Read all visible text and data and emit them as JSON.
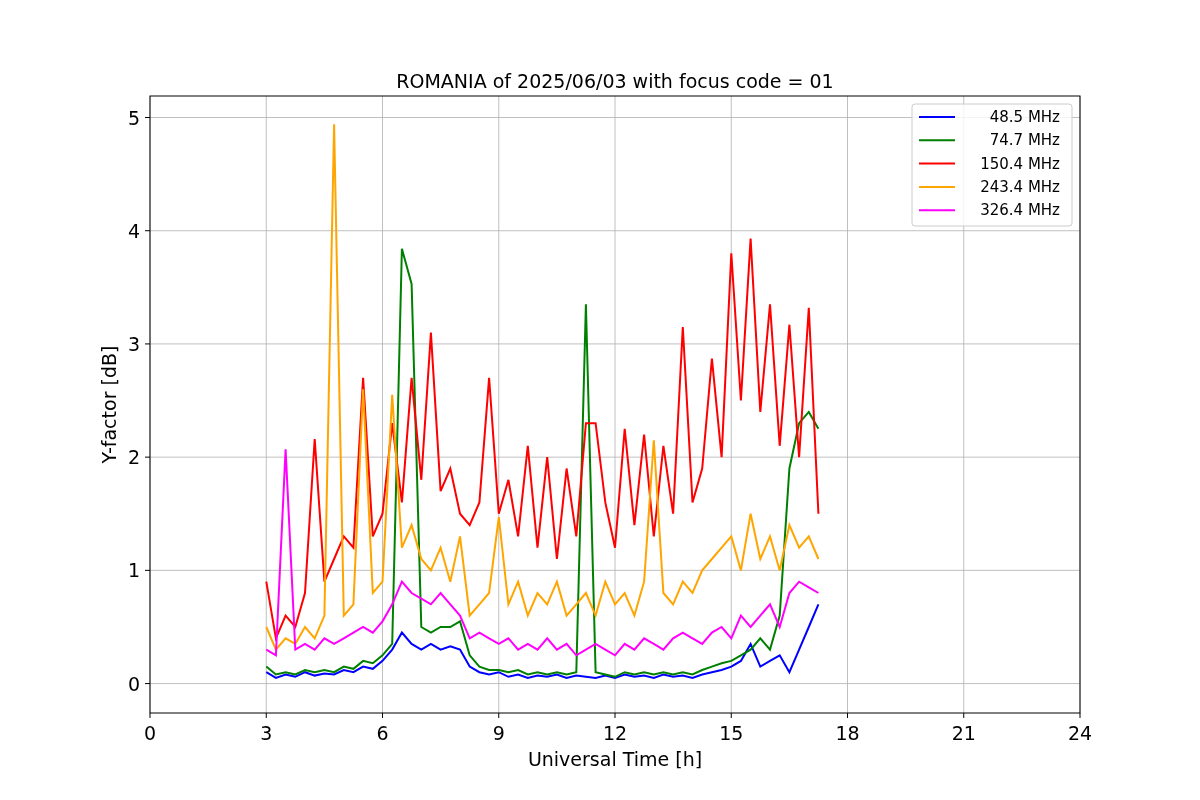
{
  "chart_data": {
    "type": "line",
    "title": "ROMANIA of 2025/06/03 with focus code = 01",
    "xlabel": "Universal Time [h]",
    "ylabel": "Y-factor [dB]",
    "x": [
      3,
      3.25,
      3.5,
      3.75,
      4,
      4.25,
      4.5,
      4.75,
      5,
      5.25,
      5.5,
      5.75,
      6,
      6.25,
      6.5,
      6.75,
      7,
      7.25,
      7.5,
      7.75,
      8,
      8.25,
      8.5,
      8.75,
      9,
      9.25,
      9.5,
      9.75,
      10,
      10.25,
      10.5,
      10.75,
      11,
      11.25,
      11.5,
      11.75,
      12,
      12.25,
      12.5,
      12.75,
      13,
      13.25,
      13.5,
      13.75,
      14,
      14.25,
      14.5,
      14.75,
      15,
      15.25,
      15.5,
      15.75,
      16,
      16.25,
      16.5,
      16.75,
      17,
      17.25
    ],
    "series": [
      {
        "name": "48.5 MHz",
        "color": "#0000ff",
        "values": [
          0.1,
          0.05,
          0.08,
          0.06,
          0.1,
          0.07,
          0.09,
          0.08,
          0.12,
          0.1,
          0.15,
          0.13,
          0.2,
          0.3,
          0.45,
          0.35,
          0.3,
          0.35,
          0.3,
          0.33,
          0.3,
          0.15,
          0.1,
          0.08,
          0.1,
          0.06,
          0.08,
          0.05,
          0.07,
          0.06,
          0.08,
          0.05,
          0.07,
          0.06,
          0.05,
          0.07,
          0.05,
          0.08,
          0.06,
          0.07,
          0.05,
          0.08,
          0.06,
          0.07,
          0.05,
          0.08,
          0.1,
          0.12,
          0.15,
          0.2,
          0.35,
          0.15,
          0.2,
          0.25,
          0.1,
          0.3,
          0.5,
          0.7
        ]
      },
      {
        "name": "74.7 MHz",
        "color": "#008000",
        "values": [
          0.15,
          0.08,
          0.1,
          0.08,
          0.12,
          0.1,
          0.12,
          0.1,
          0.15,
          0.13,
          0.2,
          0.18,
          0.25,
          0.35,
          3.84,
          3.53,
          0.5,
          0.45,
          0.5,
          0.5,
          0.55,
          0.25,
          0.15,
          0.12,
          0.12,
          0.1,
          0.12,
          0.08,
          0.1,
          0.08,
          0.1,
          0.08,
          0.1,
          3.35,
          0.1,
          0.08,
          0.06,
          0.1,
          0.08,
          0.1,
          0.08,
          0.1,
          0.08,
          0.1,
          0.08,
          0.12,
          0.15,
          0.18,
          0.2,
          0.25,
          0.3,
          0.4,
          0.3,
          0.6,
          1.9,
          2.3,
          2.4,
          2.25
        ]
      },
      {
        "name": "150.4 MHz",
        "color": "#ff0000",
        "values": [
          0.9,
          0.4,
          0.6,
          0.5,
          0.8,
          2.16,
          0.9,
          1.1,
          1.3,
          1.2,
          2.7,
          1.3,
          1.5,
          2.3,
          1.6,
          2.7,
          1.8,
          3.1,
          1.7,
          1.9,
          1.5,
          1.4,
          1.6,
          2.7,
          1.5,
          1.8,
          1.3,
          2.1,
          1.2,
          2.0,
          1.1,
          1.9,
          1.3,
          2.3,
          2.3,
          1.6,
          1.2,
          2.25,
          1.4,
          2.2,
          1.3,
          2.1,
          1.5,
          3.15,
          1.6,
          1.9,
          2.87,
          2.0,
          3.8,
          2.5,
          3.93,
          2.4,
          3.35,
          2.1,
          3.17,
          2.0,
          3.32,
          1.5
        ]
      },
      {
        "name": "243.4 MHz",
        "color": "#ffa500",
        "values": [
          0.5,
          0.3,
          0.4,
          0.35,
          0.5,
          0.4,
          0.6,
          4.94,
          0.6,
          0.7,
          2.6,
          0.8,
          0.9,
          2.55,
          1.2,
          1.4,
          1.1,
          1.0,
          1.2,
          0.9,
          1.3,
          0.6,
          0.7,
          0.8,
          1.47,
          0.7,
          0.9,
          0.6,
          0.8,
          0.7,
          0.9,
          0.6,
          0.7,
          0.8,
          0.6,
          0.9,
          0.7,
          0.8,
          0.6,
          0.9,
          2.15,
          0.8,
          0.7,
          0.9,
          0.8,
          1.0,
          1.1,
          1.2,
          1.3,
          1.0,
          1.5,
          1.1,
          1.3,
          1.0,
          1.4,
          1.2,
          1.3,
          1.1
        ]
      },
      {
        "name": "326.4 MHz",
        "color": "#ff00ff",
        "values": [
          0.3,
          0.25,
          2.07,
          0.3,
          0.35,
          0.3,
          0.4,
          0.35,
          0.4,
          0.45,
          0.5,
          0.45,
          0.55,
          0.7,
          0.9,
          0.8,
          0.75,
          0.7,
          0.8,
          0.7,
          0.6,
          0.4,
          0.45,
          0.4,
          0.35,
          0.4,
          0.3,
          0.35,
          0.3,
          0.4,
          0.3,
          0.35,
          0.25,
          0.3,
          0.35,
          0.3,
          0.25,
          0.35,
          0.3,
          0.4,
          0.35,
          0.3,
          0.4,
          0.45,
          0.4,
          0.35,
          0.45,
          0.5,
          0.4,
          0.6,
          0.5,
          0.6,
          0.7,
          0.5,
          0.8,
          0.9,
          0.85,
          0.8
        ]
      }
    ],
    "xlim": [
      0,
      24
    ],
    "ylim": [
      -0.26,
      5.19
    ],
    "xticks": [
      0,
      3,
      6,
      9,
      12,
      15,
      18,
      21,
      24
    ],
    "yticks": [
      0,
      1,
      2,
      3,
      4,
      5
    ],
    "grid": true,
    "legend": true
  }
}
